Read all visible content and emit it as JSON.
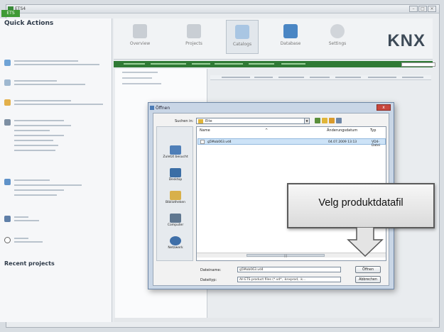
{
  "window": {
    "title": "ETS4",
    "tab": "ETS"
  },
  "left_panel": {
    "quick_actions_title": "Quick Actions",
    "recent_projects_title": "Recent projects"
  },
  "toolbar": {
    "buttons": [
      "Overview",
      "Projects",
      "Catalogs",
      "Database",
      "Settings"
    ],
    "logo": "KNX"
  },
  "dialog": {
    "title": "Öffnen",
    "look_in_label": "Suchen in:",
    "look_in_value": "Eite",
    "places": [
      "Zuletzt besucht",
      "Desktop",
      "Bibliotheken",
      "Computer",
      "Netzwerk"
    ],
    "columns": [
      "Name",
      "Änderungsdatum",
      "Typ"
    ],
    "files": [
      {
        "name": "g5Mob063.vd4",
        "date": "04.07.2009 13:13",
        "type": "VD4-Datei"
      }
    ],
    "filename_label": "Dateiname:",
    "filename_value": "g5Mob063.vd4",
    "filetype_label": "Dateityp:",
    "filetype_value": "All ETS product files (*.vd*, .knxprod, .k...",
    "open_button": "Öffnen",
    "cancel_button": "Abbrechen"
  },
  "callout": {
    "text": "Velg produktdatafil"
  },
  "colors": {
    "green": "#3f9a35",
    "dialog_frame": "#c9d6e6",
    "close_red": "#c8473d"
  },
  "icons": [
    "folder-icon",
    "desktop-icon",
    "library-icon",
    "computer-icon",
    "network-icon",
    "back-icon",
    "up-folder-icon",
    "new-folder-icon",
    "view-menu-icon"
  ]
}
